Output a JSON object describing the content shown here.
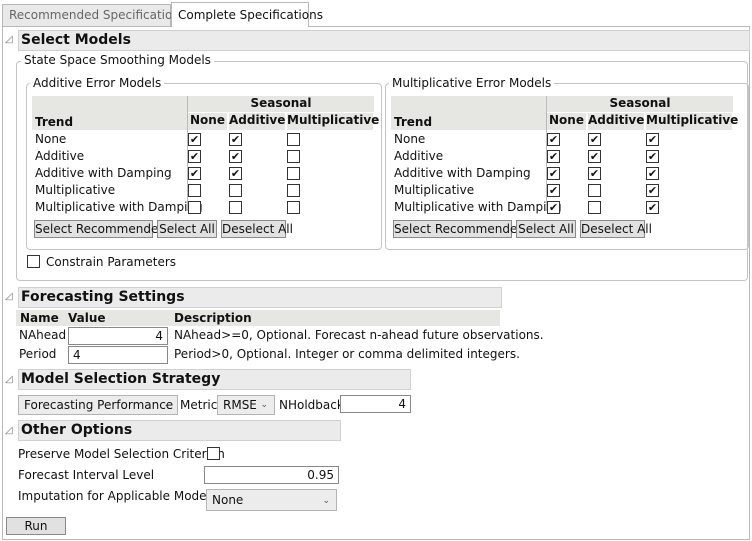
{
  "tabs": [
    {
      "label": "Recommended Specifications",
      "selected": false
    },
    {
      "label": "Complete Specifications",
      "selected": true
    }
  ],
  "select_models": {
    "title": "Select Models",
    "group": "State Space Smoothing Models",
    "additive": {
      "title": "Additive Error Models",
      "seasonal": "Seasonal",
      "trend": "Trend",
      "cols": [
        "None",
        "Additive",
        "Multiplicative"
      ],
      "rows": [
        {
          "label": "None",
          "checks": [
            true,
            true,
            false
          ]
        },
        {
          "label": "Additive",
          "checks": [
            true,
            true,
            false
          ]
        },
        {
          "label": "Additive with Damping",
          "checks": [
            true,
            true,
            false
          ]
        },
        {
          "label": "Multiplicative",
          "checks": [
            false,
            false,
            false
          ]
        },
        {
          "label": "Multiplicative with Damping",
          "checks": [
            false,
            false,
            false
          ]
        }
      ],
      "buttons": [
        "Select Recommended",
        "Select All",
        "Deselect All"
      ]
    },
    "multiplicative": {
      "title": "Multiplicative Error Models",
      "seasonal": "Seasonal",
      "trend": "Trend",
      "cols": [
        "None",
        "Additive",
        "Multiplicative"
      ],
      "rows": [
        {
          "label": "None",
          "checks": [
            true,
            true,
            true
          ]
        },
        {
          "label": "Additive",
          "checks": [
            true,
            true,
            true
          ]
        },
        {
          "label": "Additive with Damping",
          "checks": [
            true,
            true,
            true
          ]
        },
        {
          "label": "Multiplicative",
          "checks": [
            true,
            false,
            true
          ]
        },
        {
          "label": "Multiplicative with Damping",
          "checks": [
            true,
            false,
            true
          ]
        }
      ],
      "buttons": [
        "Select Recommended",
        "Select All",
        "Deselect All"
      ]
    },
    "constrain_label": "Constrain Parameters",
    "constrain_checked": false
  },
  "forecasting": {
    "title": "Forecasting Settings",
    "headers": [
      "Name",
      "Value",
      "Description"
    ],
    "rows": [
      {
        "name": "NAhead",
        "value": "4",
        "desc": "NAhead>=0, Optional. Forecast n-ahead future observations."
      },
      {
        "name": "Period",
        "value": "4",
        "desc": "Period>0, Optional. Integer or comma delimited integers."
      }
    ]
  },
  "strategy": {
    "title": "Model Selection Strategy",
    "method": "Forecasting Performance",
    "metric_label": "Metric",
    "metric": "RMSE",
    "nholdback_label": "NHoldback",
    "nholdback": "4"
  },
  "other": {
    "title": "Other Options",
    "preserve_label": "Preserve Model Selection Criterion",
    "preserve_checked": false,
    "interval_label": "Forecast Interval Level",
    "interval": "0.95",
    "imputation_label": "Imputation for Applicable Models",
    "imputation": "None"
  },
  "run_label": "Run"
}
